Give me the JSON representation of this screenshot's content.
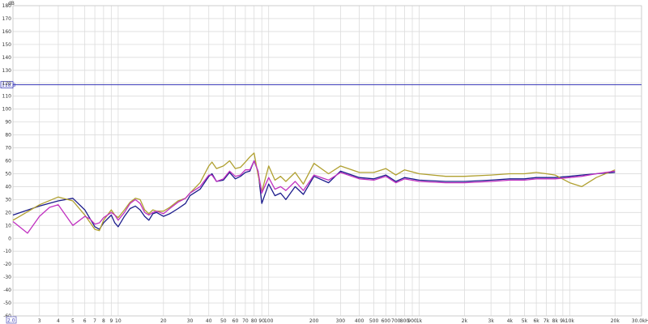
{
  "chart_data": {
    "type": "line",
    "title": "",
    "xlabel": "",
    "ylabel": "",
    "y_unit": "dB",
    "x_scale": "log",
    "xlim": [
      2,
      30000
    ],
    "ylim": [
      -60,
      180
    ],
    "grid": true,
    "legend": "none",
    "y_ticks": [
      "180",
      "170",
      "160",
      "150",
      "140",
      "130",
      "120",
      "110",
      "100",
      "90",
      "80",
      "70",
      "60",
      "50",
      "40",
      "30",
      "20",
      "10",
      "0",
      "-10",
      "-20",
      "-30",
      "-40",
      "-50",
      "-60"
    ],
    "x_ticks": [
      {
        "v": 3,
        "label": "3"
      },
      {
        "v": 4,
        "label": "4"
      },
      {
        "v": 5,
        "label": "5"
      },
      {
        "v": 6,
        "label": "6"
      },
      {
        "v": 7,
        "label": "7"
      },
      {
        "v": 8,
        "label": "8"
      },
      {
        "v": 9,
        "label": "9"
      },
      {
        "v": 10,
        "label": "10"
      },
      {
        "v": 20,
        "label": "20"
      },
      {
        "v": 30,
        "label": "30"
      },
      {
        "v": 40,
        "label": "40"
      },
      {
        "v": 50,
        "label": "50"
      },
      {
        "v": 60,
        "label": "60"
      },
      {
        "v": 70,
        "label": "70"
      },
      {
        "v": 80,
        "label": "80"
      },
      {
        "v": 90,
        "label": "90"
      },
      {
        "v": 100,
        "label": "100"
      },
      {
        "v": 200,
        "label": "200"
      },
      {
        "v": 300,
        "label": "300"
      },
      {
        "v": 400,
        "label": "400"
      },
      {
        "v": 500,
        "label": "500"
      },
      {
        "v": 600,
        "label": "600"
      },
      {
        "v": 700,
        "label": "700"
      },
      {
        "v": 800,
        "label": "800"
      },
      {
        "v": 900,
        "label": "900"
      },
      {
        "v": 1000,
        "label": "1k"
      },
      {
        "v": 2000,
        "label": "2k"
      },
      {
        "v": 3000,
        "label": "3k"
      },
      {
        "v": 4000,
        "label": "4k"
      },
      {
        "v": 5000,
        "label": "5k"
      },
      {
        "v": 6000,
        "label": "6k"
      },
      {
        "v": 7000,
        "label": "7k"
      },
      {
        "v": 8000,
        "label": "8k"
      },
      {
        "v": 9000,
        "label": "9k"
      },
      {
        "v": 10000,
        "label": "10k"
      },
      {
        "v": 20000,
        "label": "20k"
      },
      {
        "v": 30000,
        "label": "30.0kHz"
      }
    ],
    "x_start_label": "2.0",
    "cursor_line": {
      "value": 118.8,
      "label": "118.8",
      "color": "#3a3ab8"
    },
    "series": [
      {
        "color": "#1c1c8c",
        "x": [
          2,
          3,
          4,
          5,
          6,
          7,
          7.5,
          8,
          9,
          9.5,
          10,
          11,
          12,
          13,
          14,
          15,
          16,
          17,
          18,
          20,
          22,
          25,
          28,
          30,
          35,
          40,
          42,
          45,
          50,
          55,
          60,
          65,
          70,
          75,
          80,
          85,
          90,
          100,
          110,
          120,
          130,
          150,
          170,
          200,
          250,
          300,
          400,
          500,
          600,
          700,
          800,
          1000,
          1500,
          2000,
          3000,
          4000,
          5000,
          6000,
          7000,
          8000,
          10000,
          12000,
          15000,
          20000
        ],
        "y": [
          18,
          25,
          29,
          31,
          22,
          9,
          7,
          12,
          18,
          12,
          9,
          17,
          23,
          25,
          22,
          17,
          14,
          19,
          20,
          17,
          19,
          23,
          27,
          33,
          38,
          48,
          50,
          44,
          45,
          51,
          46,
          48,
          51,
          52,
          60,
          52,
          27,
          42,
          33,
          35,
          30,
          40,
          34,
          48,
          43,
          52,
          47,
          46,
          49,
          44,
          47,
          45,
          44,
          44,
          45,
          46,
          46,
          47,
          47,
          47,
          48,
          49,
          50,
          51
        ]
      },
      {
        "color": "#b0a030",
        "x": [
          2,
          3,
          4,
          5,
          6,
          7,
          7.5,
          8,
          9,
          9.5,
          10,
          11,
          12,
          13,
          14,
          15,
          16,
          17,
          18,
          20,
          22,
          25,
          28,
          30,
          35,
          40,
          42,
          45,
          50,
          55,
          60,
          65,
          70,
          75,
          80,
          85,
          90,
          100,
          110,
          120,
          130,
          150,
          170,
          200,
          250,
          300,
          400,
          500,
          600,
          700,
          800,
          1000,
          1500,
          2000,
          3000,
          4000,
          5000,
          6000,
          7000,
          8000,
          10000,
          12000,
          15000,
          20000
        ],
        "y": [
          14,
          26,
          32,
          29,
          18,
          7,
          6,
          14,
          22,
          18,
          16,
          22,
          28,
          31,
          30,
          22,
          19,
          22,
          21,
          21,
          24,
          29,
          31,
          35,
          43,
          56,
          59,
          54,
          56,
          60,
          54,
          55,
          59,
          63,
          66,
          49,
          36,
          56,
          45,
          48,
          44,
          51,
          42,
          58,
          50,
          56,
          51,
          51,
          54,
          49,
          53,
          50,
          48,
          48,
          49,
          50,
          50,
          51,
          50,
          49,
          43,
          40,
          47,
          53
        ]
      },
      {
        "color": "#c030c0",
        "x": [
          2,
          2.5,
          3,
          3.5,
          4,
          5,
          6,
          6.5,
          7,
          7.5,
          8,
          9,
          9.5,
          10,
          11,
          12,
          13,
          14,
          15,
          16,
          17,
          18,
          20,
          22,
          25,
          28,
          30,
          35,
          40,
          42,
          45,
          50,
          55,
          60,
          65,
          70,
          75,
          80,
          85,
          90,
          100,
          110,
          120,
          130,
          150,
          170,
          200,
          250,
          300,
          400,
          500,
          600,
          700,
          800,
          1000,
          1500,
          2000,
          3000,
          4000,
          5000,
          6000,
          7000,
          8000,
          10000,
          12000,
          15000,
          20000
        ],
        "y": [
          13,
          4,
          17,
          24,
          26,
          10,
          17,
          15,
          11,
          12,
          16,
          20,
          18,
          14,
          20,
          27,
          30,
          27,
          20,
          18,
          20,
          21,
          19,
          23,
          28,
          31,
          35,
          40,
          49,
          49,
          44,
          46,
          52,
          48,
          49,
          53,
          53,
          60,
          52,
          35,
          47,
          38,
          40,
          37,
          44,
          37,
          49,
          45,
          51,
          46,
          45,
          48,
          43,
          46,
          44,
          43,
          43,
          44,
          45,
          45,
          46,
          46,
          46,
          47,
          48,
          50,
          52
        ]
      }
    ]
  }
}
